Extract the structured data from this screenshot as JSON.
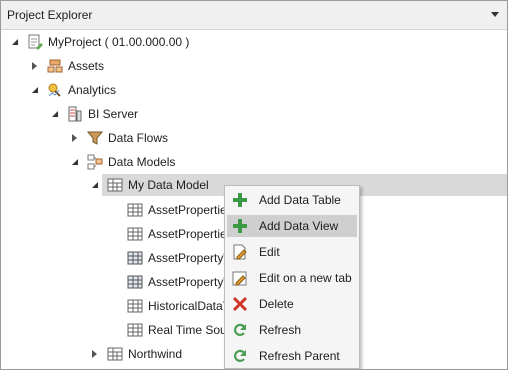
{
  "panel": {
    "title": "Project Explorer"
  },
  "tree": {
    "project": "MyProject ( 01.00.000.00 )",
    "assets": "Assets",
    "analytics": "Analytics",
    "bi_server": "BI Server",
    "data_flows": "Data Flows",
    "data_models": "Data Models",
    "my_data_model": "My Data Model",
    "children": [
      "AssetPropertie",
      "AssetPropertie",
      "AssetPropertyV",
      "AssetPropertyV",
      "HistoricalDataT",
      "Real Time Sour"
    ],
    "northwind": "Northwind"
  },
  "context_menu": {
    "items": [
      {
        "label": "Add Data Table",
        "icon": "plus-icon"
      },
      {
        "label": "Add Data View",
        "icon": "plus-icon"
      },
      {
        "label": "Edit",
        "icon": "edit-icon"
      },
      {
        "label": "Edit on a new tab",
        "icon": "edit-new-tab-icon"
      },
      {
        "label": "Delete",
        "icon": "delete-x-icon"
      },
      {
        "label": "Refresh",
        "icon": "refresh-icon"
      },
      {
        "label": "Refresh Parent",
        "icon": "refresh-parent-icon"
      }
    ],
    "hovered_item": "Add Data View"
  },
  "colors": {
    "selection": "#d9d9d9",
    "menu_hover": "#cfcfcf",
    "plus_green": "#3c9a46",
    "delete_red": "#d0342c",
    "refresh_green": "#4a9e52"
  }
}
